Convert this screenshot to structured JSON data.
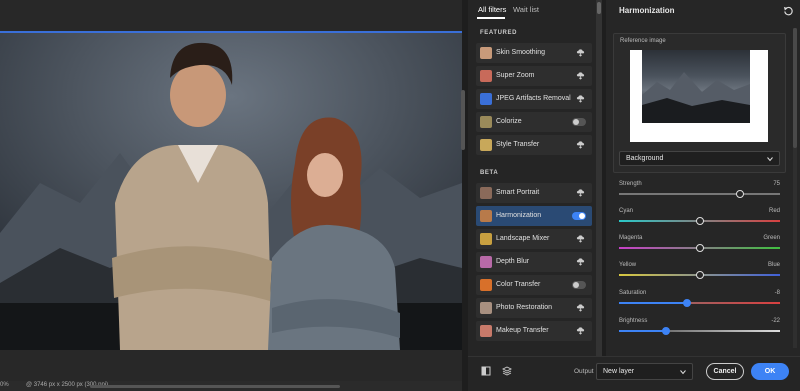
{
  "canvas": {
    "status_zoom": "0%",
    "status_info": "@ 3746 px x 2500 px (300 ppi)"
  },
  "filters": {
    "tabs": [
      {
        "label": "All filters",
        "active": true
      },
      {
        "label": "Wait list",
        "active": false
      }
    ],
    "sections": [
      {
        "label": "FEATURED",
        "items": [
          {
            "label": "Skin Smoothing",
            "control": "cloud",
            "thumb": "#c89a7a"
          },
          {
            "label": "Super Zoom",
            "control": "cloud",
            "thumb": "#c86a5a"
          },
          {
            "label": "JPEG Artifacts Removal",
            "control": "cloud",
            "thumb": "#3a6fd8"
          },
          {
            "label": "Colorize",
            "control": "toggle-off",
            "thumb": "#9a8a5a"
          },
          {
            "label": "Style Transfer",
            "control": "cloud",
            "thumb": "#c8a85a"
          }
        ]
      },
      {
        "label": "BETA",
        "items": [
          {
            "label": "Smart Portrait",
            "control": "cloud",
            "thumb": "#8a6a5a"
          },
          {
            "label": "Harmonization",
            "control": "toggle-on",
            "active": true,
            "thumb": "#b87a4a"
          },
          {
            "label": "Landscape Mixer",
            "control": "cloud",
            "thumb": "#c8a040"
          },
          {
            "label": "Depth Blur",
            "control": "cloud",
            "thumb": "#b86aa8"
          },
          {
            "label": "Color Transfer",
            "control": "toggle-off",
            "thumb": "#d8702a"
          },
          {
            "label": "Photo Restoration",
            "control": "cloud",
            "thumb": "#a89080"
          },
          {
            "label": "Makeup Transfer",
            "control": "cloud",
            "thumb": "#c87a6a"
          }
        ]
      }
    ]
  },
  "props": {
    "title": "Harmonization",
    "reference_label": "Reference image",
    "dropdown_value": "Background",
    "sliders": [
      {
        "label": "Strength",
        "left": "",
        "right": "75",
        "pos": 0.75,
        "blue": false,
        "gradient": "#777"
      },
      {
        "label": "Cyan",
        "left": "",
        "right": "Red",
        "pos": 0.5,
        "blue": false,
        "gradient": "linear-gradient(90deg,#2ac8c8,#d84040)"
      },
      {
        "label": "Magenta",
        "left": "",
        "right": "Green",
        "pos": 0.5,
        "blue": false,
        "gradient": "linear-gradient(90deg,#c840c8,#40c040)"
      },
      {
        "label": "Yellow",
        "left": "",
        "right": "Blue",
        "pos": 0.5,
        "blue": false,
        "gradient": "linear-gradient(90deg,#d8c840,#4060d8)"
      },
      {
        "label": "Saturation",
        "left": "",
        "right": "-8",
        "pos": 0.42,
        "blue": true,
        "gradient": "linear-gradient(90deg,#777,#d84040)"
      },
      {
        "label": "Brightness",
        "left": "",
        "right": "-22",
        "pos": 0.29,
        "blue": true,
        "gradient": "linear-gradient(90deg,#444,#ddd)"
      }
    ]
  },
  "bottom": {
    "output_label": "Output",
    "output_value": "New layer",
    "cancel_label": "Cancel",
    "ok_label": "OK"
  },
  "colors": {
    "accent": "#3d83f5",
    "active_item": "#2a4a74"
  }
}
